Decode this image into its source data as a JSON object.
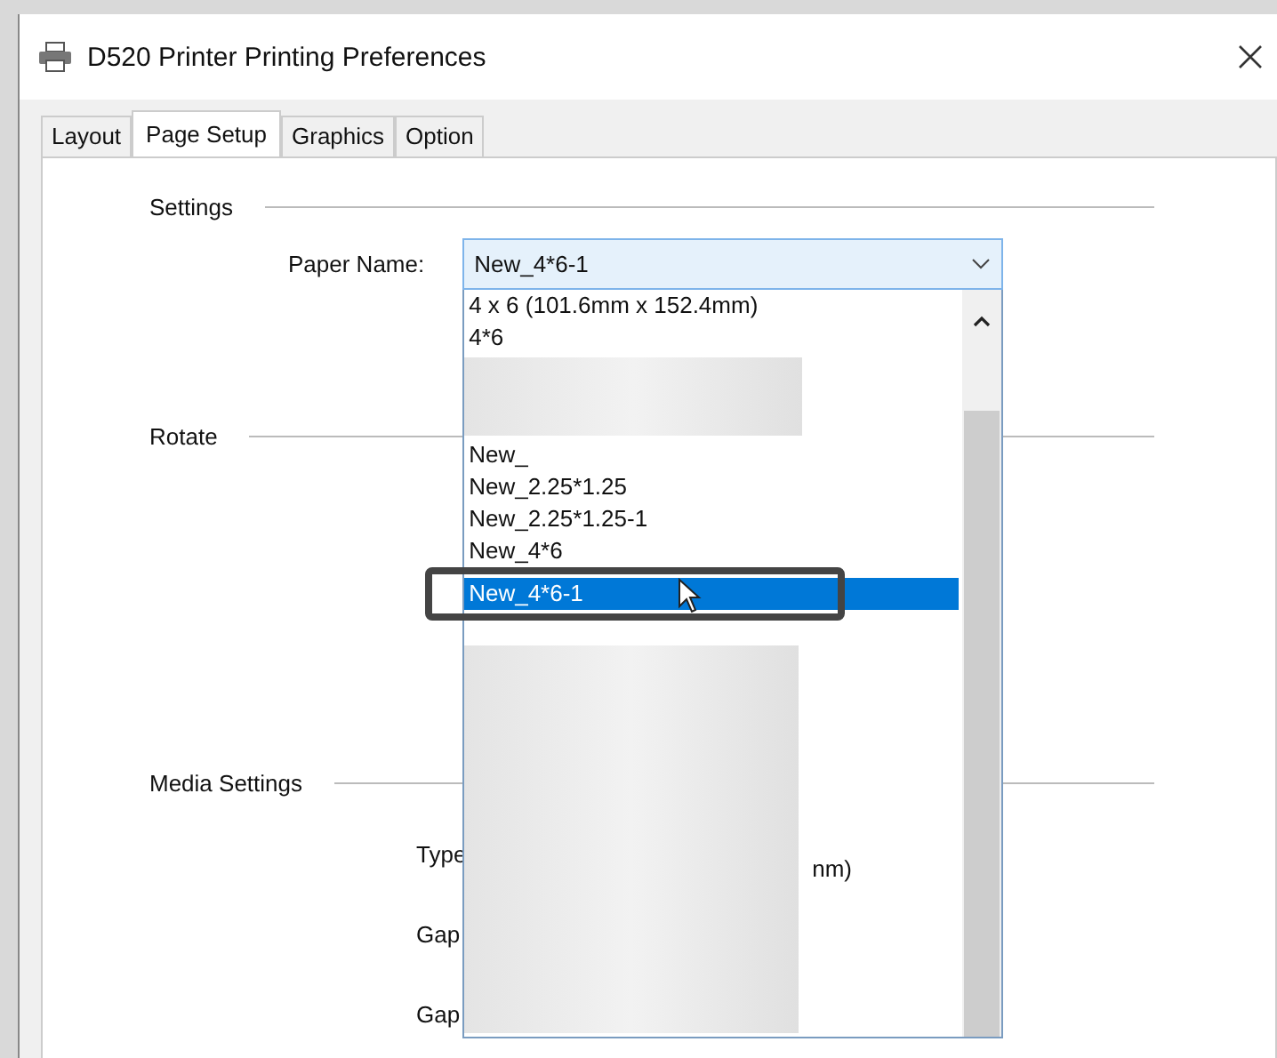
{
  "window": {
    "title": "D520 Printer Printing Preferences"
  },
  "tabs": [
    {
      "label": "Layout",
      "selected": false
    },
    {
      "label": "Page Setup",
      "selected": true
    },
    {
      "label": "Graphics",
      "selected": false
    },
    {
      "label": "Option",
      "selected": false
    }
  ],
  "settings": {
    "heading": "Settings",
    "paper_name_label": "Paper Name:",
    "paper_name_value": "New_4*6-1"
  },
  "dropdown": {
    "items": [
      {
        "kind": "text",
        "label": "4 x 6 (101.6mm x 152.4mm)",
        "selected": false,
        "annotated": false
      },
      {
        "kind": "text",
        "label": "4*6",
        "selected": false,
        "annotated": false
      },
      {
        "kind": "blurred"
      },
      {
        "kind": "text",
        "label": "New_",
        "selected": false,
        "annotated": false
      },
      {
        "kind": "text",
        "label": "New_2.25*1.25",
        "selected": false,
        "annotated": false
      },
      {
        "kind": "text",
        "label": "New_2.25*1.25-1",
        "selected": false,
        "annotated": false
      },
      {
        "kind": "text",
        "label": "New_4*6",
        "selected": false,
        "annotated": false
      },
      {
        "kind": "text",
        "label": "New_4*6-1",
        "selected": true,
        "annotated": true
      },
      {
        "kind": "blurred"
      },
      {
        "kind": "fragment",
        "label": "nm)"
      }
    ]
  },
  "rotate": {
    "heading": "Rotate"
  },
  "media_settings": {
    "heading": "Media Settings",
    "fields": [
      "Type",
      "Gap",
      "Gap"
    ]
  }
}
